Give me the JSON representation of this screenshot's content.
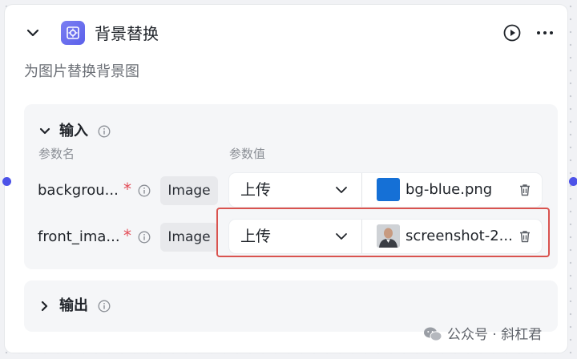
{
  "node": {
    "title": "背景替换",
    "description": "为图片替换背景图",
    "icon": "image-magic-icon"
  },
  "input_section": {
    "title": "输入",
    "col_name_header": "参数名",
    "col_value_header": "参数值",
    "params": [
      {
        "name": "backgrou...",
        "required_mark": "*",
        "type": "Image",
        "mode": "上传",
        "file_name": "bg-blue.png",
        "thumb": "blue-square"
      },
      {
        "name": "front_ima...",
        "required_mark": "*",
        "type": "Image",
        "mode": "上传",
        "file_name": "screenshot-2...",
        "thumb": "portrait-photo"
      }
    ]
  },
  "output_section": {
    "title": "输出"
  },
  "watermark": {
    "text": "公众号 · 斜杠君"
  },
  "colors": {
    "accent": "#4d53e8",
    "highlight": "#d9534f",
    "required": "#e34d59"
  }
}
